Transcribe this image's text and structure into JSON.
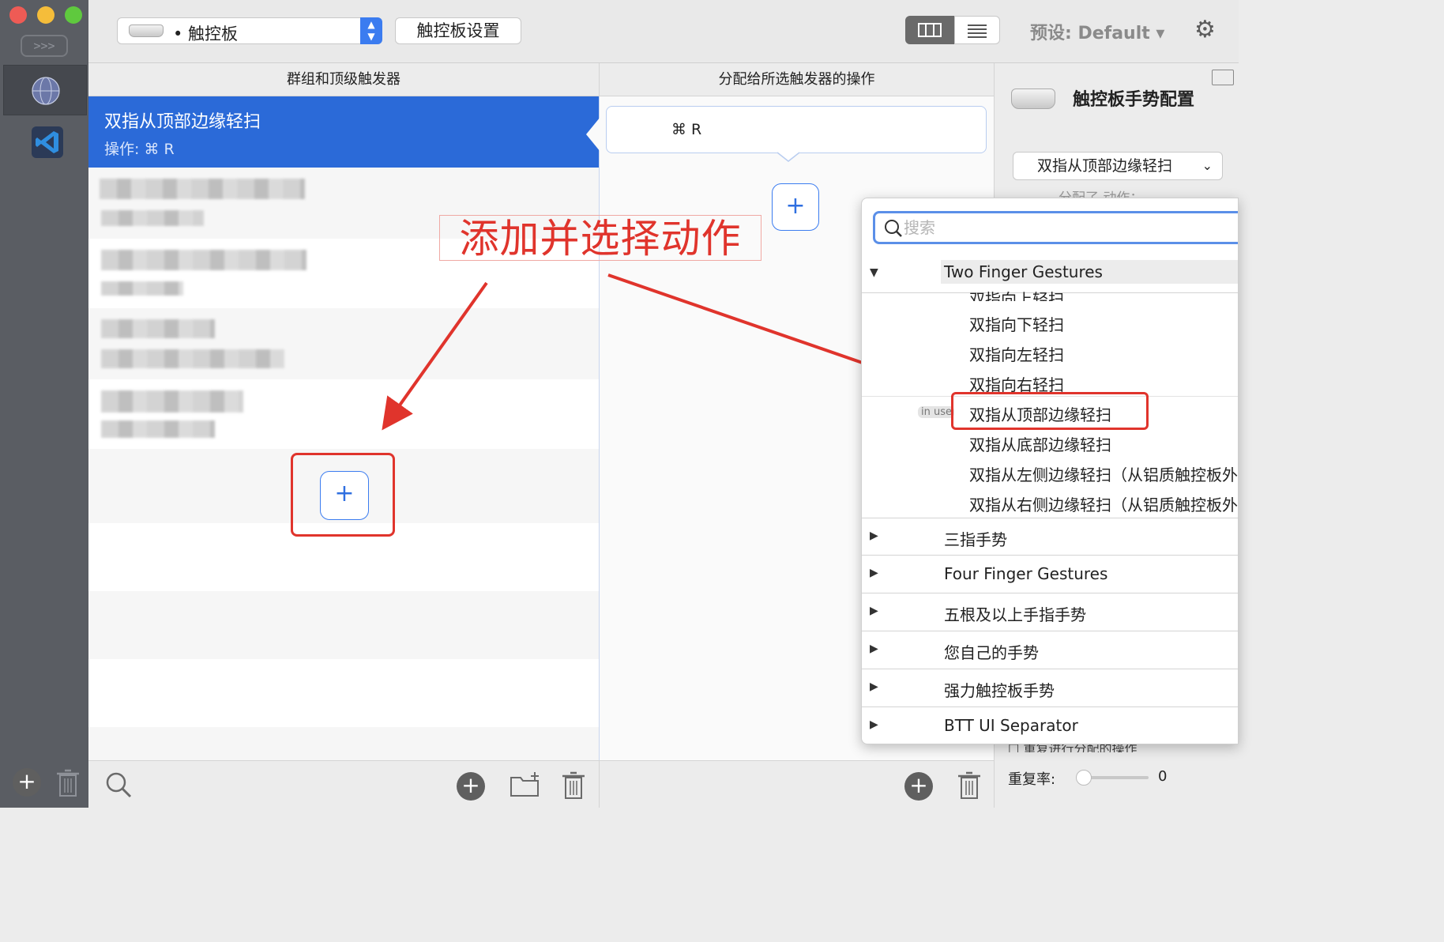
{
  "toolbar": {
    "device_label": "• 触控板",
    "settings_button": "触控板设置",
    "preset_label": "预设: Default ▾",
    "more_label": ">>>"
  },
  "columns": {
    "left_header": "群组和顶级触发器",
    "middle_header": "分配给所选触发器的操作"
  },
  "triggers": {
    "selected": {
      "title": "双指从顶部边缘轻扫",
      "action": "操作: ⌘ R"
    }
  },
  "actions": {
    "shortcut": "⌘ R"
  },
  "annotation": {
    "text": "添加并选择动作"
  },
  "inspector": {
    "title": "触控板手势配置",
    "selected_gesture": "双指从顶部边缘轻扫",
    "assigned_partial": "分配了   动作：",
    "repeat_checkbox": "重复进行分配的操作",
    "repeat_rate_label": "重复率:",
    "repeat_rate_value": "0"
  },
  "popover": {
    "search_placeholder": "搜索",
    "open_group": "Two Finger Gestures",
    "cut_item": "双指向上轻扫",
    "items": [
      "双指向下轻扫",
      "双指向左轻扫",
      "双指向右轻扫",
      "双指从顶部边缘轻扫",
      "双指从底部边缘轻扫",
      "双指从左侧边缘轻扫（从铝质触控板外",
      "双指从右侧边缘轻扫（从铝质触控板外"
    ],
    "in_use_badge": "in use",
    "groups": [
      "三指手势",
      "Four Finger Gestures",
      "五根及以上手指手势",
      "您自己的手势",
      "强力触控板手势",
      "BTT UI Separator"
    ]
  },
  "colors": {
    "selection": "#2b6ad8",
    "accent": "#3b7cf0",
    "annotation": "#e0342c"
  }
}
